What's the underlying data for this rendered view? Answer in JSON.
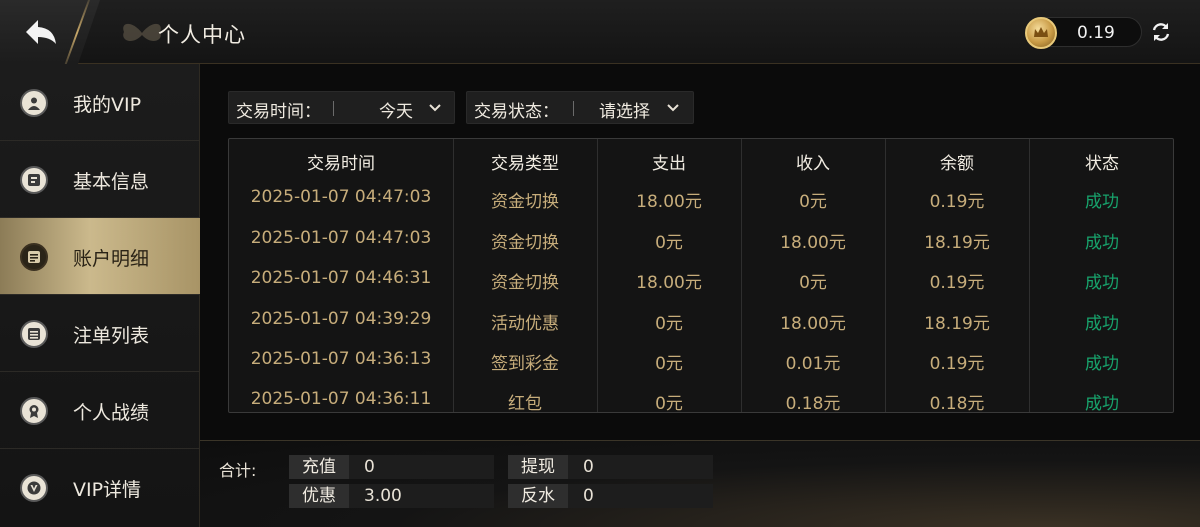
{
  "header": {
    "title": "个人中心",
    "balance": "0.19"
  },
  "sidebar": {
    "items": [
      {
        "label": "我的VIP",
        "icon": "user-icon"
      },
      {
        "label": "基本信息",
        "icon": "id-card-icon"
      },
      {
        "label": "账户明细",
        "icon": "ledger-icon",
        "active": true
      },
      {
        "label": "注单列表",
        "icon": "list-icon"
      },
      {
        "label": "个人战绩",
        "icon": "medal-icon"
      },
      {
        "label": "VIP详情",
        "icon": "vip-icon"
      }
    ]
  },
  "filters": {
    "time_label": "交易时间：",
    "time_value": "今天",
    "status_label": "交易状态：",
    "status_value": "请选择"
  },
  "table": {
    "columns": [
      "交易时间",
      "交易类型",
      "支出",
      "收入",
      "余额",
      "状态"
    ],
    "rows": [
      [
        "2025-01-07 04:47:03",
        "资金切换",
        "18.00元",
        "0元",
        "0.19元",
        "成功"
      ],
      [
        "2025-01-07 04:47:03",
        "资金切换",
        "0元",
        "18.00元",
        "18.19元",
        "成功"
      ],
      [
        "2025-01-07 04:46:31",
        "资金切换",
        "18.00元",
        "0元",
        "0.19元",
        "成功"
      ],
      [
        "2025-01-07 04:39:29",
        "活动优惠",
        "0元",
        "18.00元",
        "18.19元",
        "成功"
      ],
      [
        "2025-01-07 04:36:13",
        "签到彩金",
        "0元",
        "0.01元",
        "0.19元",
        "成功"
      ],
      [
        "2025-01-07 04:36:11",
        "红包",
        "0元",
        "0.18元",
        "0.18元",
        "成功"
      ]
    ]
  },
  "totals": {
    "label": "合计:",
    "recharge_label": "充值",
    "recharge_value": "0",
    "withdraw_label": "提现",
    "withdraw_value": "0",
    "bonus_label": "优惠",
    "bonus_value": "3.00",
    "rebate_label": "反水",
    "rebate_value": "0"
  },
  "colors": {
    "accent_gold": "#c7ad7b",
    "success_green": "#17a36c",
    "active_tab": "#cbb98c"
  }
}
